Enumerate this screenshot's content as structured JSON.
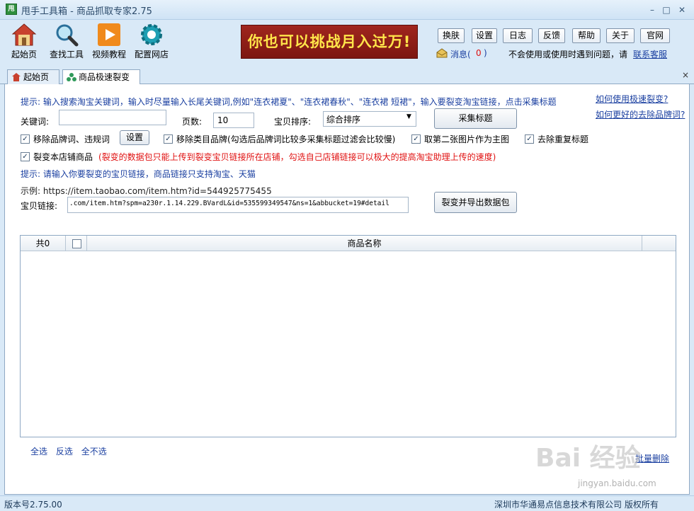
{
  "window": {
    "title": "甩手工具箱 - 商品抓取专家2.75",
    "app_icon_text": "甩",
    "minimize": "–",
    "maximize": "□",
    "close": "✕"
  },
  "toolbar": {
    "items": [
      {
        "label": "起始页",
        "icon": "home-icon"
      },
      {
        "label": "查找工具",
        "icon": "magnifier-icon"
      },
      {
        "label": "视频教程",
        "icon": "play-icon"
      },
      {
        "label": "配置网店",
        "icon": "gear-icon"
      }
    ]
  },
  "banner": {
    "text": "你也可以挑战月入过万!"
  },
  "top_buttons": [
    "换肤",
    "设置",
    "日志",
    "反馈",
    "帮助",
    "关于",
    "官网"
  ],
  "message": {
    "label": "消息(",
    "count": "0",
    "close": ")"
  },
  "help": {
    "text": "不会使用或使用时遇到问题，请",
    "link": "联系客服"
  },
  "tabs": [
    {
      "label": "起始页",
      "icon": "home-icon"
    },
    {
      "label": "商品极速裂变",
      "icon": "split-icon"
    }
  ],
  "tab_close": "×",
  "hint1": "提示: 输入搜索淘宝关键词，输入时尽量输入长尾关键词,例如\"连衣裙夏\"、\"连衣裙春秋\"、\"连衣裙 短裙\"，输入要裂变淘宝链接，点击采集标题",
  "right_links": [
    "如何使用极速裂变?",
    "如何更好的去除品牌词?"
  ],
  "form": {
    "keyword_label": "关键词:",
    "keyword_value": "",
    "pages_label": "页数:",
    "pages_value": "10",
    "sort_label": "宝贝排序:",
    "sort_value": "综合排序",
    "collect_button": "采集标题"
  },
  "options": {
    "remove_brand": "移除品牌词、违规词",
    "settings_button": "设置",
    "remove_category_brand": "移除类目品牌(勾选后品牌词比较多采集标题过滤会比较慢)",
    "second_image": "取第二张图片作为主图",
    "dedupe": "去除重复标题",
    "split_shop": "裂变本店铺商品",
    "split_note": "(裂变的数据包只能上传到裂变宝贝链接所在店铺，勾选自己店铺链接可以极大的提高淘宝助理上传的速度)"
  },
  "hint2": "提示: 请输入你要裂变的宝贝链接，商品链接只支持淘宝、天猫",
  "example": "示例: https://item.taobao.com/item.htm?id=544925775455",
  "link_label": "宝贝链接:",
  "link_value": ".com/item.htm?spm=a230r.1.14.229.BVardL&id=535599349547&ns=1&abbucket=19#detail",
  "export_button": "裂变并导出数据包",
  "grid": {
    "count_label": "共0",
    "column": "商品名称"
  },
  "bottom_links": [
    "全选",
    "反选",
    "全不选"
  ],
  "batch_delete": "批量删除",
  "status": {
    "version": "版本号2.75.00",
    "copyright": "深圳市华通易点信息技术有限公司 版权所有"
  },
  "watermark": {
    "brand": "Bai 经验",
    "url": "jingyan.baidu.com"
  },
  "colors": {
    "link": "#1a3fa0",
    "warning": "#e01010",
    "banner_bg": "#8c1d16",
    "banner_text": "#ffe54a",
    "frame": "#d9e9f7"
  }
}
